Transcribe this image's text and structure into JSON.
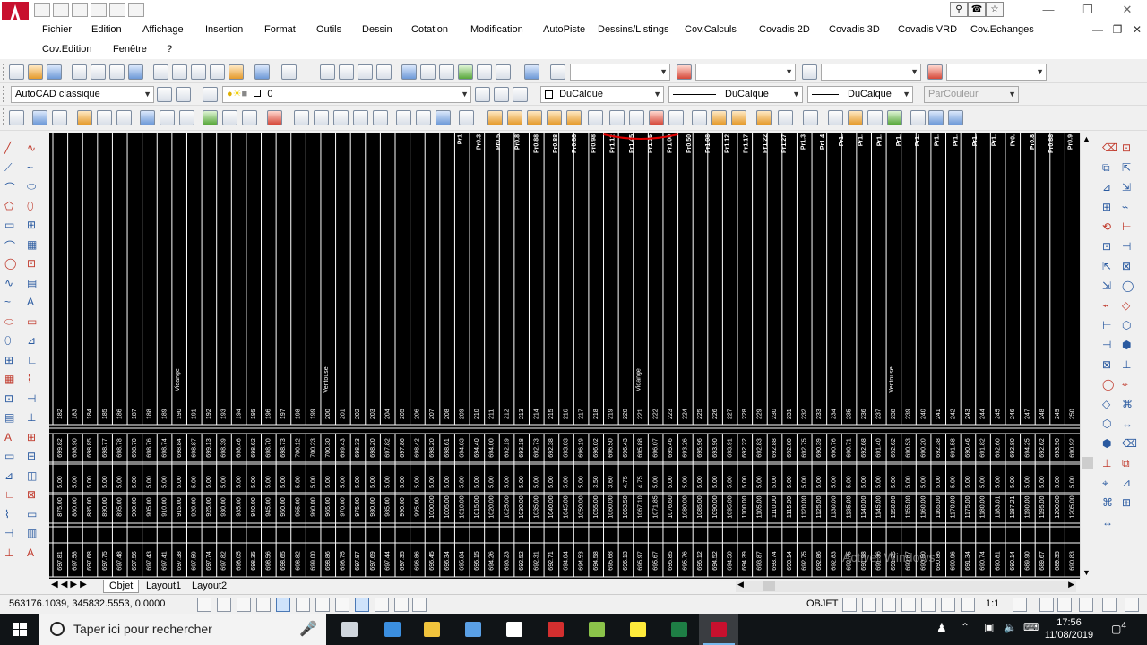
{
  "window": {
    "app": "AutoCAD",
    "controls": [
      "minimize-icon",
      "restore-icon",
      "close-icon"
    ]
  },
  "menu": {
    "items": [
      "Fichier",
      "Edition",
      "Affichage",
      "Insertion",
      "Format",
      "Outils",
      "Dessin",
      "Cotation",
      "Modification",
      "AutoPiste",
      "Dessins/Listings",
      "Cov.Calculs",
      "Covadis 2D",
      "Covadis 3D",
      "Covadis VRD",
      "Cov.Echanges",
      "Cov.Edition",
      "Fenêtre",
      "?"
    ]
  },
  "toolbar": {
    "workspace": "AutoCAD classique",
    "layer": "0",
    "color": "DuCalque",
    "linetype": "DuCalque",
    "lineweight": "DuCalque",
    "plotstyle": "ParCouleur"
  },
  "drawing": {
    "background": "#000000",
    "line_color": "#ffffff",
    "accent_color": "#e00000",
    "profile_labels": [
      "Pr1",
      "Pr0.3",
      "Pr0.5",
      "Pr0.8",
      "Pr0.88",
      "Pr0.88",
      "Pr0.88",
      "Pr0.98",
      "Pr1.12",
      "Pr1.45",
      "Pr1.15",
      "Pr1.00",
      "Pr0.50",
      "Pr1.08",
      "Pr1.12",
      "Pr1.17",
      "Pr1.22",
      "Pr1.27",
      "Pr1.3",
      "Pr1.4",
      "Pr1.",
      "Pr1.",
      "Pr1.",
      "Pr1.",
      "Pr1.",
      "Pr1.",
      "Pr1.",
      "Pr1.",
      "Pr1.",
      "Pr0.",
      "Pr0.8",
      "Pr0.88",
      "Pr0.9"
    ],
    "markers": [
      "Vidange",
      "Ventouse",
      "Vidange",
      "Ventouse"
    ],
    "station_numbers": [
      "182",
      "183",
      "184",
      "185",
      "186",
      "187",
      "188",
      "189",
      "190",
      "191",
      "192",
      "193",
      "194",
      "195",
      "196",
      "197",
      "198",
      "199",
      "200",
      "201",
      "202",
      "203",
      "204",
      "205",
      "206",
      "207",
      "208",
      "209",
      "210",
      "211",
      "212",
      "213",
      "214",
      "215",
      "216",
      "217",
      "218",
      "219",
      "220",
      "221",
      "222",
      "223",
      "224",
      "225",
      "226",
      "227",
      "228",
      "229",
      "230",
      "231",
      "232",
      "233",
      "234",
      "235",
      "236",
      "237",
      "238",
      "239",
      "240",
      "241",
      "242",
      "243",
      "244",
      "245",
      "246",
      "247",
      "248",
      "249",
      "250"
    ],
    "row_tn": [
      "699.82",
      "698.90",
      "698.85",
      "698.77",
      "698.78",
      "698.70",
      "698.76",
      "698.74",
      "698.84",
      "698.87",
      "699.13",
      "698.39",
      "698.46",
      "698.62",
      "698.70",
      "698.73",
      "700.12",
      "700.23",
      "700.30",
      "699.43",
      "698.33",
      "698.20",
      "697.82",
      "697.86",
      "698.42",
      "698.20",
      "698.61",
      "694.63",
      "694.40",
      "694.00",
      "692.19",
      "693.18",
      "692.73",
      "692.38",
      "693.03",
      "696.19",
      "696.02",
      "696.50",
      "696.43",
      "695.88",
      "696.07",
      "695.46",
      "693.26",
      "695.96",
      "693.90",
      "693.91",
      "692.22",
      "692.83",
      "692.88",
      "692.80",
      "692.75",
      "690.39",
      "690.76",
      "690.71",
      "692.68",
      "691.40",
      "692.62",
      "690.53",
      "690.20",
      "692.38",
      "691.58",
      "690.46",
      "691.82",
      "692.60",
      "692.80",
      "694.25",
      "692.62",
      "693.90",
      "690.92"
    ],
    "row_dist": [
      "5.00",
      "5.00",
      "5.00",
      "5.00",
      "5.00",
      "5.00",
      "5.00",
      "5.00",
      "5.00",
      "5.00",
      "5.00",
      "5.00",
      "5.00",
      "5.00",
      "5.00",
      "5.00",
      "5.00",
      "5.00",
      "5.00",
      "5.00",
      "5.00",
      "5.00",
      "5.00",
      "5.00",
      "5.00",
      "5.00",
      "5.00",
      "5.00",
      "5.00",
      "5.00",
      "5.00",
      "5.00",
      "5.00",
      "5.00",
      "5.00",
      "5.00",
      "3.50",
      "3.60",
      "4.75",
      "4.75",
      "5.00",
      "5.00",
      "5.00",
      "5.00",
      "5.00",
      "5.00",
      "5.00",
      "5.00",
      "5.00",
      "5.00",
      "5.00",
      "5.00",
      "5.00",
      "5.00",
      "5.00",
      "5.00",
      "5.00",
      "5.00",
      "5.00",
      "5.00",
      "5.00",
      "5.00",
      "5.00",
      "5.00",
      "5.00",
      "5.00",
      "5.00",
      "5.00",
      "5.00"
    ],
    "row_cumul": [
      "875.00",
      "880.00",
      "885.00",
      "890.00",
      "895.00",
      "900.00",
      "905.00",
      "910.00",
      "915.00",
      "920.00",
      "925.00",
      "930.00",
      "935.00",
      "940.00",
      "945.00",
      "950.00",
      "955.00",
      "960.00",
      "965.00",
      "970.00",
      "975.00",
      "980.00",
      "985.00",
      "990.00",
      "995.00",
      "1000.00",
      "1005.00",
      "1010.00",
      "1015.00",
      "1020.00",
      "1025.00",
      "1030.00",
      "1035.00",
      "1040.00",
      "1045.00",
      "1050.00",
      "1055.00",
      "1060.00",
      "1063.50",
      "1067.10",
      "1071.85",
      "1076.60",
      "1080.00",
      "1085.00",
      "1090.00",
      "1095.00",
      "1100.00",
      "1105.00",
      "1110.00",
      "1115.00",
      "1120.00",
      "1125.00",
      "1130.00",
      "1135.00",
      "1140.00",
      "1145.00",
      "1150.00",
      "1155.00",
      "1160.00",
      "1165.00",
      "1170.00",
      "1175.00",
      "1180.00",
      "1183.01",
      "1187.21",
      "1190.00",
      "1195.00",
      "1200.00",
      "1205.00"
    ],
    "row_proj": [
      "697.81",
      "697.58",
      "697.68",
      "697.75",
      "697.48",
      "697.56",
      "697.43",
      "697.41",
      "697.38",
      "697.59",
      "697.74",
      "697.82",
      "698.05",
      "698.35",
      "698.56",
      "698.65",
      "698.82",
      "699.00",
      "698.86",
      "698.75",
      "697.97",
      "697.69",
      "697.44",
      "697.35",
      "696.86",
      "696.45",
      "696.34",
      "695.84",
      "695.15",
      "694.26",
      "693.23",
      "692.52",
      "692.31",
      "692.71",
      "694.04",
      "694.53",
      "694.58",
      "695.68",
      "696.13",
      "695.97",
      "695.67",
      "695.85",
      "695.76",
      "695.12",
      "694.52",
      "694.50",
      "694.39",
      "693.87",
      "693.74",
      "693.14",
      "692.75",
      "692.86",
      "692.83",
      "692.75",
      "691.98",
      "691.36",
      "691.25",
      "690.87",
      "690.50",
      "690.86",
      "690.96",
      "691.34",
      "690.74",
      "690.81",
      "690.14",
      "689.90",
      "689.67",
      "689.35",
      "690.83"
    ]
  },
  "tabs": {
    "items": [
      "Objet",
      "Layout1",
      "Layout2"
    ],
    "active": "Objet"
  },
  "status": {
    "coordinates": "563176.1039, 345832.5553, 0.0000",
    "objet_label": "OBJET",
    "scale": "1:1"
  },
  "watermark": {
    "line1": "Activer Windows"
  },
  "taskbar": {
    "search_placeholder": "Taper ici pour rechercher",
    "time": "17:56",
    "date": "11/08/2019",
    "notif_count": "4",
    "apps": [
      "task-view-icon",
      "edge-icon",
      "file-explorer-icon",
      "store-icon",
      "mail-icon",
      "media-player-icon",
      "movie-maker-icon",
      "app-icon",
      "excel-icon",
      "autocad-icon"
    ]
  }
}
